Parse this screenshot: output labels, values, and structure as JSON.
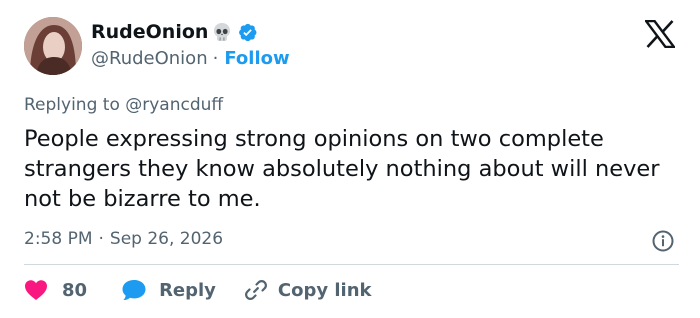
{
  "author": {
    "display_name": "RudeOnion",
    "handle": "@RudeOnion",
    "separator": "·",
    "follow_label": "Follow",
    "badges": [
      "skull-emoji",
      "verified-badge"
    ]
  },
  "platform": {
    "logo": "x-logo"
  },
  "tweet": {
    "replying_to_prefix": "Replying to",
    "replying_to_handle": "@ryancduff",
    "text": "People expressing strong opinions on two complete strangers they know absolutely nothing about will never not be bizarre to me.",
    "time": "2:58 PM",
    "separator": "·",
    "date": "Sep 26, 2026"
  },
  "actions": {
    "like_count": "80",
    "reply_label": "Reply",
    "copy_link_label": "Copy link"
  },
  "colors": {
    "accent": "#1d9bf0",
    "like": "#f91880",
    "text": "#0f1419",
    "muted": "#536471",
    "divider": "#cfd9de"
  }
}
